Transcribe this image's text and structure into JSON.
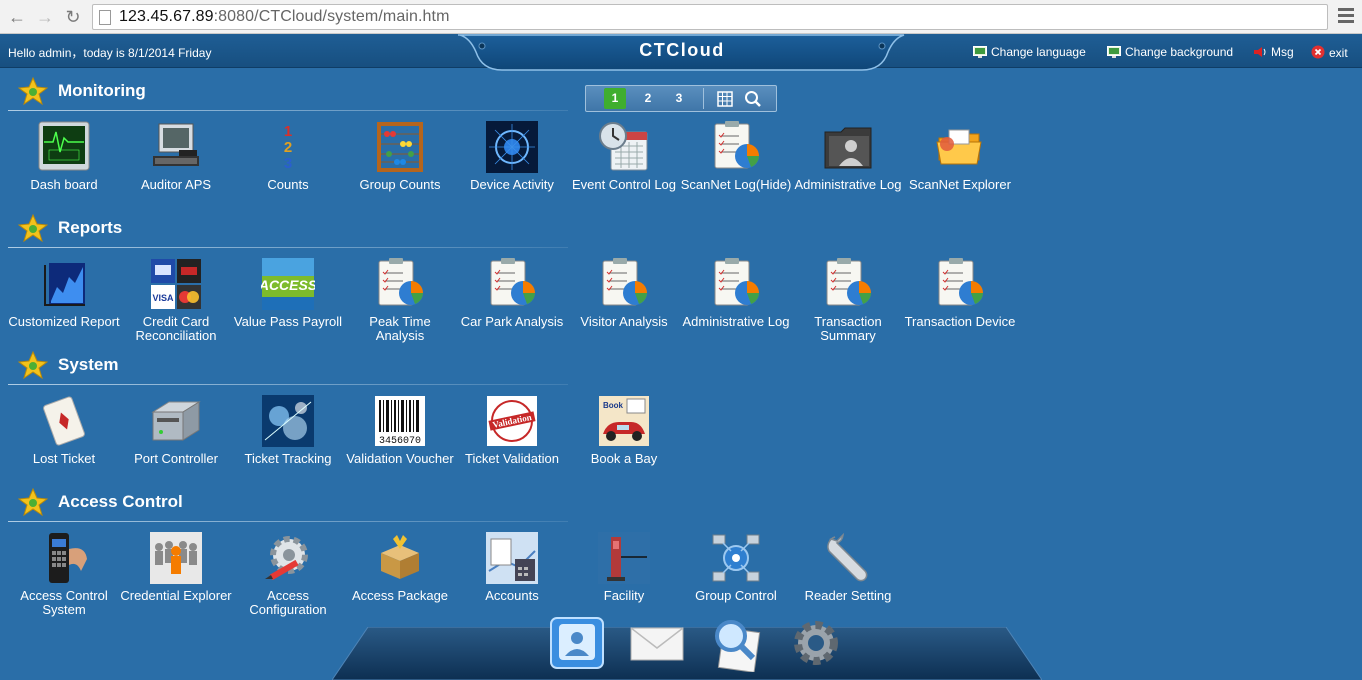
{
  "browser": {
    "url_host": "123.45.67.89",
    "url_rest": ":8080/CTCloud/system/main.htm"
  },
  "header": {
    "greeting": "Hello admin，today is 8/1/2014 Friday",
    "app_title": "CTCloud",
    "links": {
      "change_language": "Change language",
      "change_background": "Change background",
      "msg": "Msg",
      "exit": "exit"
    }
  },
  "pager": {
    "pages": [
      "1",
      "2",
      "3"
    ],
    "current": "1"
  },
  "sections": {
    "monitoring": {
      "title": "Monitoring",
      "items": [
        {
          "label": "Dash board",
          "icon": "dashboard-monitor-icon"
        },
        {
          "label": "Auditor APS",
          "icon": "computer-terminal-icon"
        },
        {
          "label": "Counts",
          "icon": "numbers-icon"
        },
        {
          "label": "Group Counts",
          "icon": "abacus-icon"
        },
        {
          "label": "Device Activity",
          "icon": "network-globe-icon"
        },
        {
          "label": "Event Control Log",
          "icon": "clock-calendar-icon"
        },
        {
          "label": "ScanNet Log(Hide)",
          "icon": "clipboard-chart-icon"
        },
        {
          "label": "Administrative Log",
          "icon": "user-folder-icon"
        },
        {
          "label": "ScanNet Explorer",
          "icon": "folder-explorer-icon"
        }
      ]
    },
    "reports": {
      "title": "Reports",
      "items": [
        {
          "label": "Customized Report",
          "icon": "chart-report-icon"
        },
        {
          "label": "Credit Card Reconciliation",
          "icon": "credit-cards-icon"
        },
        {
          "label": "Value Pass Payroll",
          "icon": "access-pass-icon"
        },
        {
          "label": "Peak Time Analysis",
          "icon": "clipboard-chart-icon"
        },
        {
          "label": "Car Park Analysis",
          "icon": "clipboard-chart-icon"
        },
        {
          "label": "Visitor Analysis",
          "icon": "clipboard-chart-icon"
        },
        {
          "label": "Administrative Log",
          "icon": "clipboard-chart-icon"
        },
        {
          "label": "Transaction Summary",
          "icon": "clipboard-chart-icon"
        },
        {
          "label": "Transaction Device",
          "icon": "clipboard-chart-icon"
        }
      ]
    },
    "system": {
      "title": "System",
      "items": [
        {
          "label": "Lost Ticket",
          "icon": "ticket-card-icon"
        },
        {
          "label": "Port Controller",
          "icon": "server-box-icon"
        },
        {
          "label": "Ticket Tracking",
          "icon": "tracking-icon"
        },
        {
          "label": "Validation Voucher",
          "icon": "barcode-icon"
        },
        {
          "label": "Ticket Validation",
          "icon": "validation-stamp-icon"
        },
        {
          "label": "Book a Bay",
          "icon": "car-booking-icon"
        }
      ]
    },
    "access_control": {
      "title": "Access Control",
      "items": [
        {
          "label": "Access Control System",
          "icon": "keypad-lock-icon"
        },
        {
          "label": "Credential Explorer",
          "icon": "crowd-person-icon"
        },
        {
          "label": "Access Configuration",
          "icon": "gear-pencil-icon"
        },
        {
          "label": "Access Package",
          "icon": "package-box-icon"
        },
        {
          "label": "Accounts",
          "icon": "calculator-document-icon"
        },
        {
          "label": "Facility",
          "icon": "turnstile-gate-icon"
        },
        {
          "label": "Group Control",
          "icon": "network-gears-icon"
        },
        {
          "label": "Reader Setting",
          "icon": "wrench-icon"
        }
      ]
    }
  },
  "dock": [
    "user-profile-icon",
    "mail-envelope-icon",
    "search-document-icon",
    "settings-gear-icon"
  ],
  "colors": {
    "background": "#2a6ea8",
    "topbar": "#1a5488",
    "text": "#ffffff"
  }
}
